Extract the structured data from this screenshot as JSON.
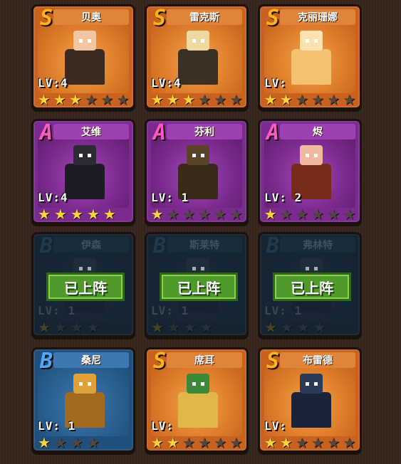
{
  "heroes": [
    {
      "rank": "S",
      "name": "贝奥",
      "level": "LV:4",
      "stars": 3,
      "deployed": false,
      "skin": "#f1c6a0",
      "outfit": "#3a2a20"
    },
    {
      "rank": "S",
      "name": "雷克斯",
      "level": "LV:4",
      "stars": 3,
      "deployed": false,
      "skin": "#f0d9a0",
      "outfit": "#3a3024"
    },
    {
      "rank": "S",
      "name": "克丽珊娜",
      "level": "LV:",
      "stars": 2,
      "deployed": false,
      "skin": "#ffe1b0",
      "outfit": "#f3c270"
    },
    {
      "rank": "A",
      "name": "艾维",
      "level": "LV:4",
      "stars": 5,
      "deployed": false,
      "skin": "#2b2b33",
      "outfit": "#1c1c24"
    },
    {
      "rank": "A",
      "name": "芬利",
      "level": "LV: 1",
      "stars": 1,
      "deployed": false,
      "skin": "#5a4428",
      "outfit": "#3a2a1a"
    },
    {
      "rank": "A",
      "name": "烬",
      "level": "LV: 2",
      "stars": 1,
      "deployed": false,
      "skin": "#f0b8a0",
      "outfit": "#7a2a18"
    },
    {
      "rank": "B",
      "name": "伊森",
      "level": "LV: 1",
      "stars": 1,
      "deployed": true,
      "skin": "#2b3b48",
      "outfit": "#1e2c38"
    },
    {
      "rank": "B",
      "name": "斯莱特",
      "level": "LV: 1",
      "stars": 1,
      "deployed": true,
      "skin": "#2b3b48",
      "outfit": "#1e2c38"
    },
    {
      "rank": "B",
      "name": "弗林特",
      "level": "LV: 1",
      "stars": 1,
      "deployed": true,
      "skin": "#2b3b48",
      "outfit": "#1e2c38"
    },
    {
      "rank": "B",
      "name": "桑尼",
      "level": "LV: 1",
      "stars": 1,
      "deployed": false,
      "skin": "#e0a03a",
      "outfit": "#a06a20"
    },
    {
      "rank": "S",
      "name": "席耳",
      "level": "LV:",
      "stars": 2,
      "deployed": false,
      "skin": "#3a8a3a",
      "outfit": "#e0b84a"
    },
    {
      "rank": "S",
      "name": "布雷德",
      "level": "LV:",
      "stars": 2,
      "deployed": false,
      "skin": "#2a3a58",
      "outfit": "#1a2438"
    }
  ],
  "deployed_label": "已上阵",
  "colors": {
    "star_on": "#ffd23a",
    "star_off": "#52463f",
    "deployed_green": "#4f9a2a"
  },
  "icons": {
    "star": "star-icon",
    "rank": "rank-badge-icon"
  }
}
